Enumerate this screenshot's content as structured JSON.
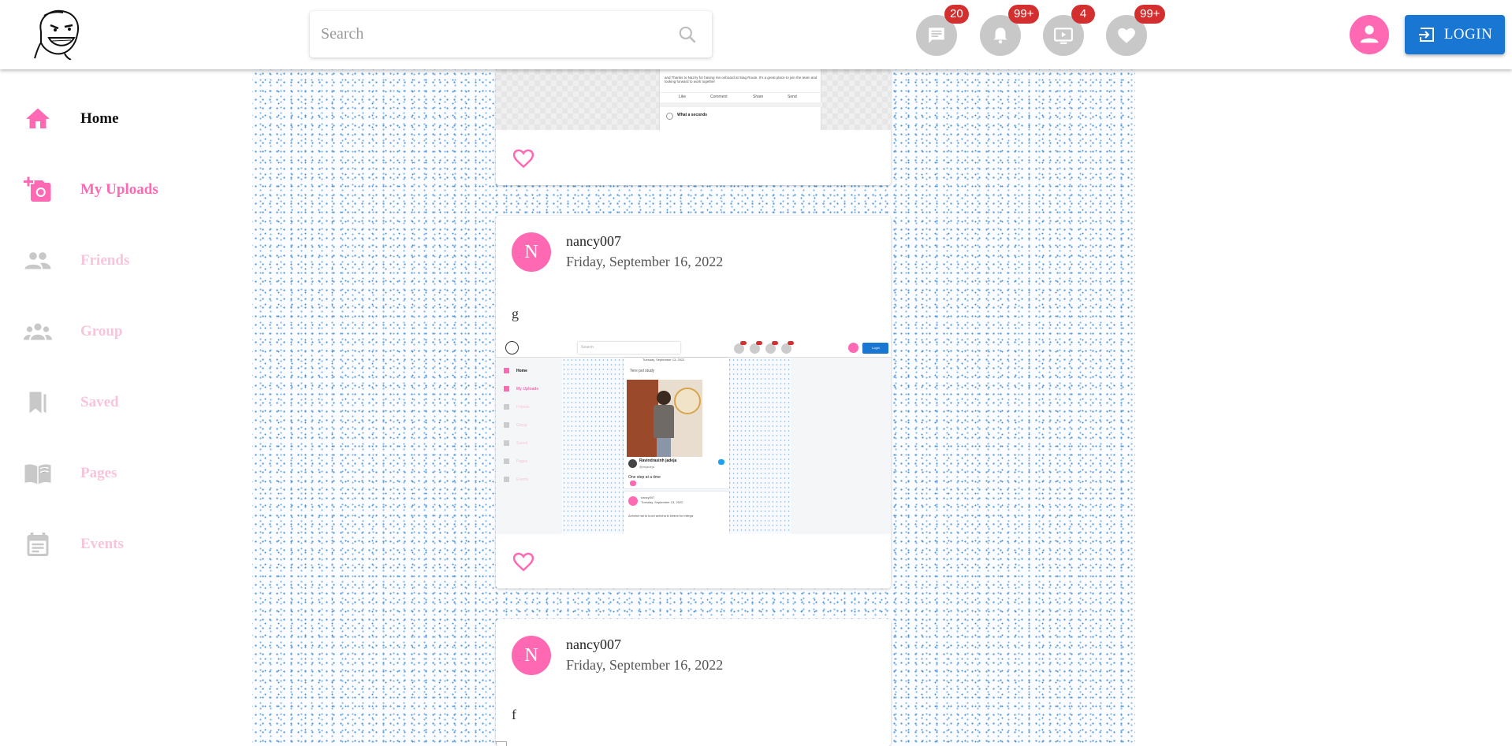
{
  "header": {
    "search_placeholder": "Search",
    "badges": {
      "messages": "20",
      "notifications": "99+",
      "videos": "4",
      "likes": "99+"
    },
    "login_label": "LOGIN"
  },
  "sidebar": {
    "items": [
      {
        "label": "Home",
        "icon": "home-icon"
      },
      {
        "label": "My Uploads",
        "icon": "add-photo-icon"
      },
      {
        "label": "Friends",
        "icon": "people-icon"
      },
      {
        "label": "Group",
        "icon": "groups-icon"
      },
      {
        "label": "Saved",
        "icon": "bookmarks-icon"
      },
      {
        "label": "Pages",
        "icon": "book-icon"
      },
      {
        "label": "Events",
        "icon": "calendar-icon"
      }
    ]
  },
  "posts": [
    {
      "author_initial": "N",
      "author": "nancy007",
      "date": "Friday, September 16, 2022",
      "text": "g",
      "image": {
        "top_search_placeholder": "Search",
        "login_label": "Login",
        "sidebar": [
          "Home",
          "My Uploads",
          "Friends",
          "Group",
          "Saved",
          "Pages",
          "Events"
        ],
        "post_date": "Tuesday, September 13, 2022",
        "post_text": "Tere pol study",
        "tweet_name": "Ravindrasinh jadeja",
        "tweet_handle": "@imjadeja",
        "tweet_text": "One step at a time",
        "next_author": "nancy007",
        "next_date": "Tuesday, September 13, 2022",
        "next_text": "Achcha hai to kuch achcha ki khane ko milega"
      }
    },
    {
      "author_initial": "N",
      "author": "nancy007",
      "date": "Friday, September 16, 2022",
      "text": "f"
    }
  ],
  "partial_post": {
    "image_text": "and Thanks to Naziry for having me onboard at Siag Route. It's a great place to join the team and looking forward to work together",
    "actions": [
      "Like",
      "Comment",
      "Share",
      "Send"
    ],
    "comment_name": "What a seconds"
  },
  "colors": {
    "accent": "#ff69b4",
    "accent_faded": "#f8c4dc",
    "login": "#1976d2",
    "badge": "#d32f2f",
    "icon_grey": "#c8c8c8"
  }
}
